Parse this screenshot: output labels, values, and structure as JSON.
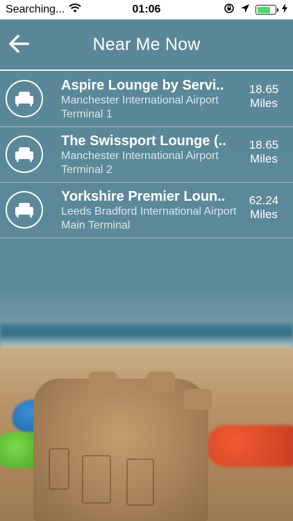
{
  "status_bar": {
    "carrier": "Searching...",
    "time": "01:06",
    "battery_level": 0.75,
    "battery_color": "#4cd964"
  },
  "navbar": {
    "title": "Near Me Now",
    "back_icon": "arrow-left-icon"
  },
  "lounges": [
    {
      "name": "Aspire Lounge by Servi..",
      "airport": "Manchester International Airport",
      "terminal": "Terminal 1",
      "distance_value": "18.65",
      "distance_unit": "Miles",
      "icon": "armchair-icon"
    },
    {
      "name": "The Swissport Lounge (..",
      "airport": "Manchester International Airport",
      "terminal": "Terminal 2",
      "distance_value": "18.65",
      "distance_unit": "Miles",
      "icon": "armchair-icon"
    },
    {
      "name": "Yorkshire Premier Loun..",
      "airport": "Leeds Bradford International Airport",
      "terminal": "Main Terminal",
      "distance_value": "62.24",
      "distance_unit": "Miles",
      "icon": "armchair-icon"
    }
  ],
  "colors": {
    "background": "#5d8a99",
    "text": "#ffffff",
    "subtext": "#d9e6ea"
  }
}
